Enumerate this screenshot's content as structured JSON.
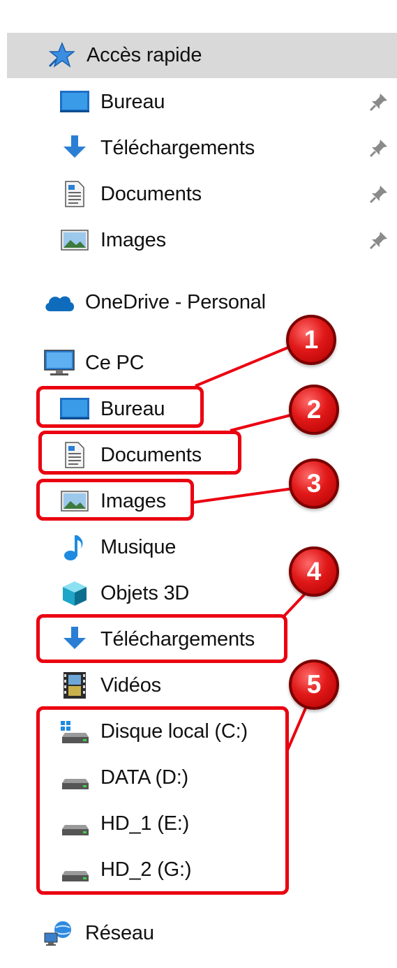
{
  "quick_access": {
    "label": "Accès rapide",
    "items": [
      {
        "label": "Bureau",
        "icon": "desktop-icon",
        "pinned": true
      },
      {
        "label": "Téléchargements",
        "icon": "download-icon",
        "pinned": true
      },
      {
        "label": "Documents",
        "icon": "document-icon",
        "pinned": true
      },
      {
        "label": "Images",
        "icon": "pictures-icon",
        "pinned": true
      }
    ]
  },
  "onedrive": {
    "label": "OneDrive - Personal",
    "icon": "onedrive-cloud-icon"
  },
  "this_pc": {
    "label": "Ce PC",
    "items": [
      {
        "label": "Bureau",
        "icon": "desktop-icon"
      },
      {
        "label": "Documents",
        "icon": "document-icon"
      },
      {
        "label": "Images",
        "icon": "pictures-icon"
      },
      {
        "label": "Musique",
        "icon": "music-note-icon"
      },
      {
        "label": "Objets 3D",
        "icon": "cube-3d-icon"
      },
      {
        "label": "Téléchargements",
        "icon": "download-icon"
      },
      {
        "label": "Vidéos",
        "icon": "film-icon"
      },
      {
        "label": "Disque local (C:)",
        "icon": "windows-drive-icon"
      },
      {
        "label": "DATA (D:)",
        "icon": "drive-icon"
      },
      {
        "label": "HD_1 (E:)",
        "icon": "drive-icon"
      },
      {
        "label": "HD_2 (G:)",
        "icon": "drive-icon"
      }
    ]
  },
  "network": {
    "label": "Réseau",
    "icon": "network-icon"
  },
  "annotations": {
    "badges": [
      "1",
      "2",
      "3",
      "4",
      "5"
    ],
    "color": "#ea0010"
  },
  "colors": {
    "selection": "#d9d9d9",
    "folder_blue": "#2a7fd4",
    "annotation_red": "#ea0010"
  }
}
